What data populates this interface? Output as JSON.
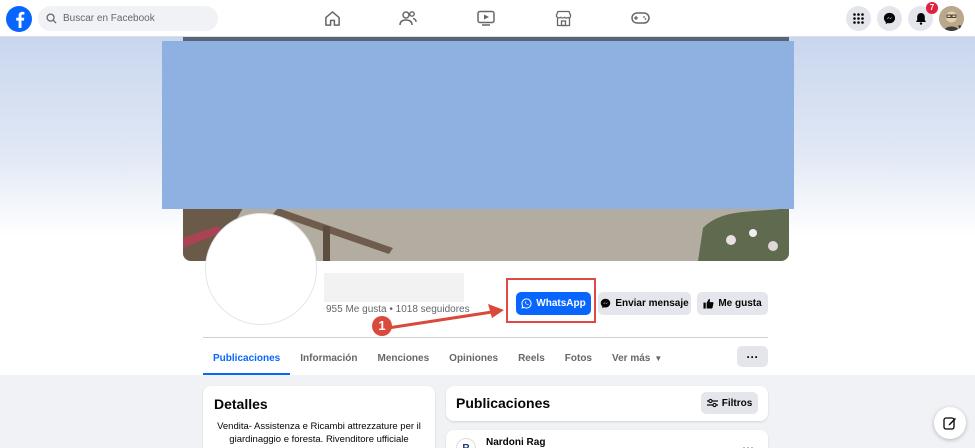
{
  "topnav": {
    "search_placeholder": "Buscar en Facebook",
    "notifications_count": "7"
  },
  "profile": {
    "stats": "955 Me gusta • 1018 seguidores"
  },
  "actions": {
    "whatsapp_label": "WhatsApp",
    "message_label": "Enviar mensaje",
    "like_label": "Me gusta"
  },
  "annotation": {
    "step_number": "1"
  },
  "tabs": [
    {
      "label": "Publicaciones"
    },
    {
      "label": "Información"
    },
    {
      "label": "Menciones"
    },
    {
      "label": "Opiniones"
    },
    {
      "label": "Reels"
    },
    {
      "label": "Fotos"
    },
    {
      "label": "Ver más"
    }
  ],
  "tabs_more": "···",
  "details": {
    "title": "Detalles",
    "text": "Vendita- Assistenza e Ricambi attrezzature per il giardinaggio e foresta. Rivenditore ufficiale"
  },
  "posts": {
    "title": "Publicaciones",
    "filter_label": "Filtros",
    "first_author": "Nardoni Rag",
    "menu": "···"
  },
  "colors": {
    "brand": "#0866ff",
    "highlight": "#e04848",
    "cover_overlay": "#8eb1e2"
  }
}
